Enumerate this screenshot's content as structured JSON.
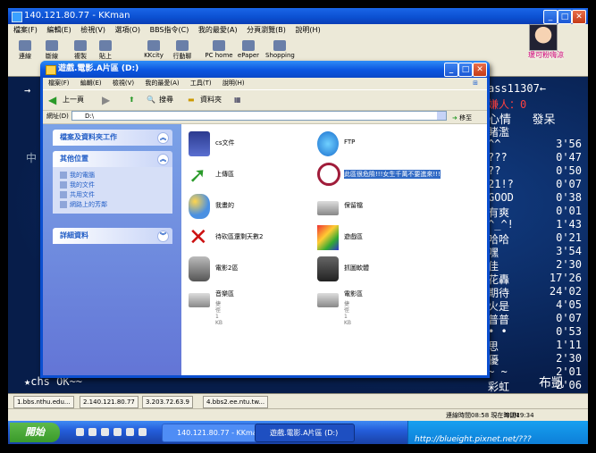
{
  "kkman": {
    "title": "140.121.80.77 - KKman",
    "menu": [
      "檔案(F)",
      "編輯(E)",
      "檢視(V)",
      "選項(O)",
      "BBS指令(C)",
      "我的最愛(A)",
      "分頁瀏覽(B)",
      "說明(H)"
    ],
    "toolbar": [
      "連線",
      "斷線",
      "複製",
      "貼上",
      "KKcity",
      "行動聊天",
      "PC home",
      "ePaper",
      "Shopping"
    ],
    "user_nick": "瑗可粉嗨涼",
    "tabs": [
      "1.bbs.nthu.edu...",
      "2.140.121.80.77",
      "3.203.72.63.9",
      "4.bbs2.ee.ntu.tw..."
    ],
    "status_connect": "連線時間08:58 現在時間19:34",
    "status_num": "NUM"
  },
  "bbs": {
    "header": "ass11307←",
    "visitor": "嫌人：0",
    "mood_label": "心情",
    "mood_value": "發呆",
    "left_arrow": "→",
    "left_char": "中",
    "rows": [
      {
        "name": "睹濫",
        "value": ""
      },
      {
        "name": "^^",
        "value": "3'56"
      },
      {
        "name": "???",
        "value": "0'47"
      },
      {
        "name": "??",
        "value": "0'50"
      },
      {
        "name": "21!?",
        "value": "0'07"
      },
      {
        "name": "GOOD",
        "value": "0'38"
      },
      {
        "name": "有爽",
        "value": "0'01"
      },
      {
        "name": "^_^!",
        "value": "1'43"
      },
      {
        "name": "哈哈",
        "value": "0'21"
      },
      {
        "name": "嘿",
        "value": "3'54"
      },
      {
        "name": "佳",
        "value": "2'30"
      },
      {
        "name": "花轟",
        "value": "17'26"
      },
      {
        "name": "期待",
        "value": "24'02"
      },
      {
        "name": "火是",
        "value": "4'05"
      },
      {
        "name": "普普",
        "value": "0'07"
      },
      {
        "name": "• •",
        "value": "0'53"
      },
      {
        "name": "思",
        "value": "1'11"
      },
      {
        "name": "優",
        "value": "2'30"
      },
      {
        "name": "~ ~",
        "value": "2'01"
      },
      {
        "name": "彩虹",
        "value": "2'06"
      }
    ],
    "status_line": "★chs OK~~",
    "corner_text": "布凱"
  },
  "explorer": {
    "title": "遊戲.電影.A片區 (D:)",
    "menu": [
      "檔案(F)",
      "編輯(E)",
      "檢視(V)",
      "我的最愛(A)",
      "工具(T)",
      "說明(H)"
    ],
    "back_label": "上一頁",
    "search_label": "搜尋",
    "folders_label": "資料夾",
    "address_label": "網址(D)",
    "address_value": "D:\\",
    "go_label": "移至",
    "panels": {
      "tasks_title": "檔案及資料夾工作",
      "places_title": "其他位置",
      "places": [
        "我的電腦",
        "我的文件",
        "共用文件",
        "網路上的芳鄰"
      ],
      "details_title": "詳細資料"
    },
    "files": [
      {
        "label": "cs文件",
        "icon": "phone-icon"
      },
      {
        "label": "FTP",
        "icon": "globe-icon"
      },
      {
        "label": "上傳區",
        "icon": "upload-arrow-icon"
      },
      {
        "label": "此區很危險!!!女生千萬不要進來!!!",
        "icon": "prohibited-icon",
        "selected": true
      },
      {
        "label": "我畫的",
        "icon": "paint-icon"
      },
      {
        "label": "保留檔",
        "icon": "drive-icon"
      },
      {
        "label": "待砍區還剩天數2",
        "icon": "red-x-icon"
      },
      {
        "label": "遊戲區",
        "icon": "installer-icon"
      },
      {
        "label": "電影2區",
        "icon": "projector-icon"
      },
      {
        "label": "抓圖軟體",
        "icon": "camera-icon"
      },
      {
        "label": "音樂區",
        "icon": "shortcut-drive-icon",
        "sub1": "捷徑",
        "sub2": "1 KB"
      },
      {
        "label": "電影區",
        "icon": "shortcut-drive-icon",
        "sub1": "捷徑",
        "sub2": "1 KB"
      }
    ]
  },
  "taskbar": {
    "start_label": "開始",
    "buttons": [
      "140.121.80.77 - KKman",
      "遊戲.電影.A片區 (D:)"
    ],
    "watermark": "http://blueight.pixnet.net/???"
  },
  "colors": {
    "xp_blue": "#0b4fd0",
    "task_pane": "#6375d6",
    "selection": "#316ac5",
    "bbs_bg": "#071d4a"
  }
}
